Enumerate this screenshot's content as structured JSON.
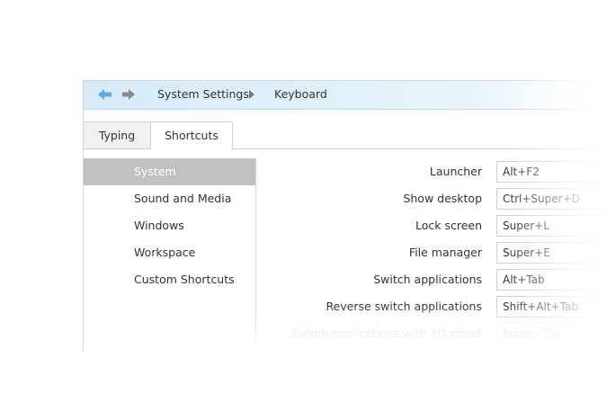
{
  "toolbar": {
    "back_icon": "back-arrow-icon",
    "forward_icon": "forward-arrow-icon",
    "breadcrumb": [
      "System Settings",
      "Keyboard"
    ]
  },
  "tabs": [
    {
      "label": "Typing",
      "active": false
    },
    {
      "label": "Shortcuts",
      "active": true
    }
  ],
  "sidebar": {
    "items": [
      {
        "label": "System",
        "selected": true
      },
      {
        "label": "Sound and Media",
        "selected": false
      },
      {
        "label": "Windows",
        "selected": false
      },
      {
        "label": "Workspace",
        "selected": false
      },
      {
        "label": "Custom Shortcuts",
        "selected": false
      }
    ]
  },
  "shortcuts": [
    {
      "label": "Launcher",
      "value": "Alt+F2"
    },
    {
      "label": "Show desktop",
      "value": "Ctrl+Super+D"
    },
    {
      "label": "Lock screen",
      "value": "Super+L"
    },
    {
      "label": "File manager",
      "value": "Super+E"
    },
    {
      "label": "Switch applications",
      "value": "Alt+Tab"
    },
    {
      "label": "Reverse switch applications",
      "value": "Shift+Alt+Tab"
    },
    {
      "label": "Switch applications with 3D effect",
      "value": "Super+Tab"
    }
  ],
  "colors": {
    "toolbar_bg": "#d6ecf8",
    "selected_bg": "#c1c1c1",
    "back_arrow": "#5aa9e6",
    "forward_arrow": "#8a8a8a"
  }
}
